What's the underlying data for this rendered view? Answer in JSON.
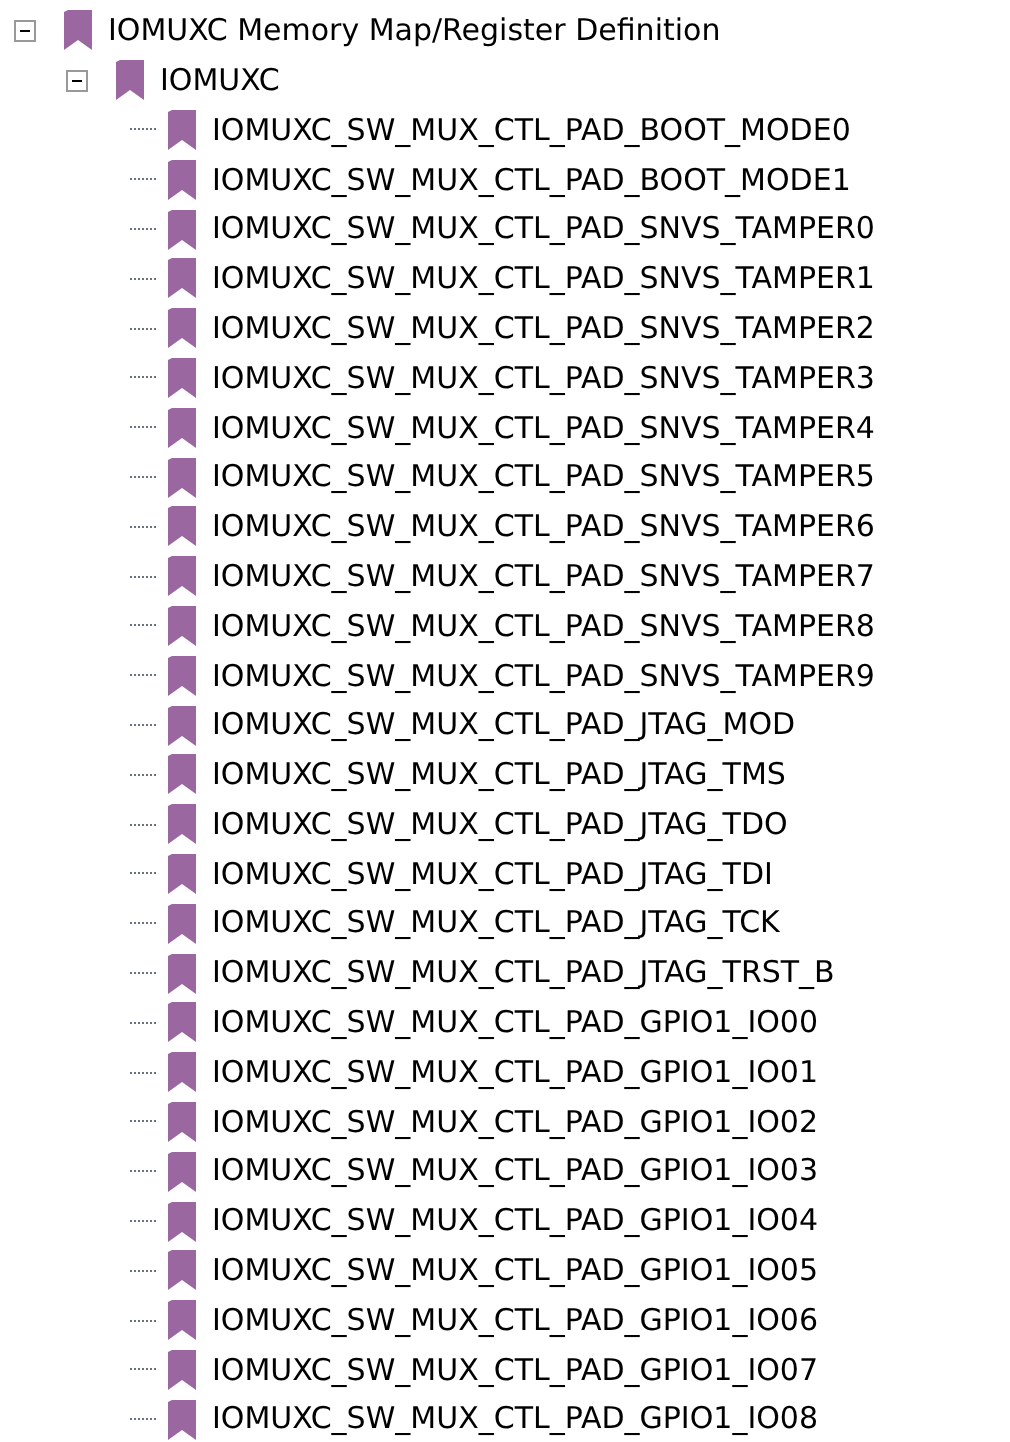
{
  "tree": [
    {
      "label": "IOMUXC Memory Map/Register Definition",
      "expanded": true,
      "children": [
        {
          "label": "IOMUXC",
          "expanded": true,
          "children": [
            {
              "label": "IOMUXC_SW_MUX_CTL_PAD_BOOT_MODE0"
            },
            {
              "label": "IOMUXC_SW_MUX_CTL_PAD_BOOT_MODE1"
            },
            {
              "label": "IOMUXC_SW_MUX_CTL_PAD_SNVS_TAMPER0"
            },
            {
              "label": "IOMUXC_SW_MUX_CTL_PAD_SNVS_TAMPER1"
            },
            {
              "label": "IOMUXC_SW_MUX_CTL_PAD_SNVS_TAMPER2"
            },
            {
              "label": "IOMUXC_SW_MUX_CTL_PAD_SNVS_TAMPER3"
            },
            {
              "label": "IOMUXC_SW_MUX_CTL_PAD_SNVS_TAMPER4"
            },
            {
              "label": "IOMUXC_SW_MUX_CTL_PAD_SNVS_TAMPER5"
            },
            {
              "label": "IOMUXC_SW_MUX_CTL_PAD_SNVS_TAMPER6"
            },
            {
              "label": "IOMUXC_SW_MUX_CTL_PAD_SNVS_TAMPER7"
            },
            {
              "label": "IOMUXC_SW_MUX_CTL_PAD_SNVS_TAMPER8"
            },
            {
              "label": "IOMUXC_SW_MUX_CTL_PAD_SNVS_TAMPER9"
            },
            {
              "label": "IOMUXC_SW_MUX_CTL_PAD_JTAG_MOD"
            },
            {
              "label": "IOMUXC_SW_MUX_CTL_PAD_JTAG_TMS"
            },
            {
              "label": "IOMUXC_SW_MUX_CTL_PAD_JTAG_TDO"
            },
            {
              "label": "IOMUXC_SW_MUX_CTL_PAD_JTAG_TDI"
            },
            {
              "label": "IOMUXC_SW_MUX_CTL_PAD_JTAG_TCK"
            },
            {
              "label": "IOMUXC_SW_MUX_CTL_PAD_JTAG_TRST_B"
            },
            {
              "label": "IOMUXC_SW_MUX_CTL_PAD_GPIO1_IO00"
            },
            {
              "label": "IOMUXC_SW_MUX_CTL_PAD_GPIO1_IO01"
            },
            {
              "label": "IOMUXC_SW_MUX_CTL_PAD_GPIO1_IO02"
            },
            {
              "label": "IOMUXC_SW_MUX_CTL_PAD_GPIO1_IO03"
            },
            {
              "label": "IOMUXC_SW_MUX_CTL_PAD_GPIO1_IO04"
            },
            {
              "label": "IOMUXC_SW_MUX_CTL_PAD_GPIO1_IO05"
            },
            {
              "label": "IOMUXC_SW_MUX_CTL_PAD_GPIO1_IO06"
            },
            {
              "label": "IOMUXC_SW_MUX_CTL_PAD_GPIO1_IO07"
            },
            {
              "label": "IOMUXC_SW_MUX_CTL_PAD_GPIO1_IO08"
            }
          ]
        }
      ]
    }
  ]
}
